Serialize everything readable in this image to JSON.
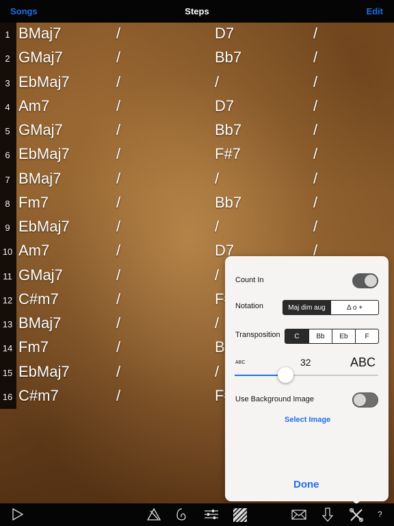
{
  "navbar": {
    "left_label": "Songs",
    "title": "Steps",
    "right_label": "Edit"
  },
  "rows": [
    {
      "num": "1",
      "cells": [
        "BMaj7",
        "/",
        "D7",
        "/"
      ]
    },
    {
      "num": "2",
      "cells": [
        "GMaj7",
        "/",
        "Bb7",
        "/"
      ]
    },
    {
      "num": "3",
      "cells": [
        "EbMaj7",
        "/",
        "/",
        "/"
      ]
    },
    {
      "num": "4",
      "cells": [
        "Am7",
        "/",
        "D7",
        "/"
      ]
    },
    {
      "num": "5",
      "cells": [
        "GMaj7",
        "/",
        "Bb7",
        "/"
      ]
    },
    {
      "num": "6",
      "cells": [
        "EbMaj7",
        "/",
        "F#7",
        "/"
      ]
    },
    {
      "num": "7",
      "cells": [
        "BMaj7",
        "/",
        "/",
        "/"
      ]
    },
    {
      "num": "8",
      "cells": [
        "Fm7",
        "/",
        "Bb7",
        "/"
      ]
    },
    {
      "num": "9",
      "cells": [
        "EbMaj7",
        "/",
        "/",
        "/"
      ]
    },
    {
      "num": "10",
      "cells": [
        "Am7",
        "/",
        "D7",
        "/"
      ]
    },
    {
      "num": "11",
      "cells": [
        "GMaj7",
        "/",
        "/",
        "/"
      ]
    },
    {
      "num": "12",
      "cells": [
        "C#m7",
        "/",
        "F#7",
        "/"
      ]
    },
    {
      "num": "13",
      "cells": [
        "BMaj7",
        "/",
        "/",
        "/"
      ]
    },
    {
      "num": "14",
      "cells": [
        "Fm7",
        "/",
        "Bb7",
        "/"
      ]
    },
    {
      "num": "15",
      "cells": [
        "EbMaj7",
        "/",
        "/",
        "/"
      ]
    },
    {
      "num": "16",
      "cells": [
        "C#m7",
        "/",
        "F#7",
        "/"
      ]
    }
  ],
  "settings": {
    "count_in_label": "Count In",
    "count_in_on": true,
    "notation_label": "Notation",
    "notation_options": [
      "Maj dim aug",
      "Δ  o +"
    ],
    "notation_selected": 0,
    "transposition_label": "Transposition",
    "transposition_options": [
      "C",
      "Bb",
      "Eb",
      "F"
    ],
    "transposition_selected": 0,
    "font_small_label": "ABC",
    "font_size_value": "32",
    "font_large_label": "ABC",
    "font_slider_fraction": 0.35,
    "bg_image_label": "Use Background Image",
    "bg_image_on": false,
    "select_image_label": "Select Image",
    "done_label": "Done"
  },
  "toolbar": {
    "icons": [
      "play-icon",
      "clear-icon",
      "metronome-icon",
      "mixer-icon",
      "pattern-icon",
      "mail-icon",
      "download-icon",
      "tools-icon",
      "help-icon"
    ],
    "help_label": "?"
  },
  "colors": {
    "accent": "#1e6fe8",
    "bar": "#050505",
    "chord_text": "#ffffff"
  }
}
